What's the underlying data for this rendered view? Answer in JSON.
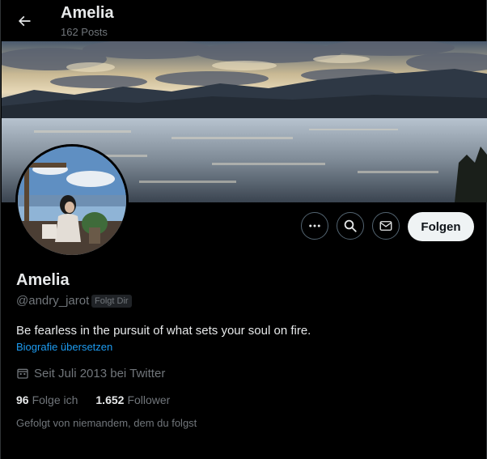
{
  "header": {
    "title": "Amelia",
    "posts_count": "162 Posts"
  },
  "profile": {
    "display_name": "Amelia",
    "handle": "@andry_jarot",
    "follows_you_badge": "Folgt Dir",
    "bio": "Be fearless in the pursuit of what sets your soul on fire.",
    "translate_link": "Biografie übersetzen",
    "joined": "Seit Juli 2013 bei Twitter",
    "following_count": "96",
    "following_label": "Folge ich",
    "followers_count": "1.652",
    "followers_label": "Follower",
    "followed_by": "Gefolgt von niemandem, dem du folgst"
  },
  "actions": {
    "follow_label": "Folgen",
    "icons": [
      "more-icon",
      "search-icon",
      "message-icon"
    ]
  },
  "colors": {
    "background": "#000000",
    "text_primary": "#e7e9ea",
    "text_secondary": "#71767b",
    "link": "#1d9bf0",
    "follow_button_bg": "#eff3f4"
  }
}
